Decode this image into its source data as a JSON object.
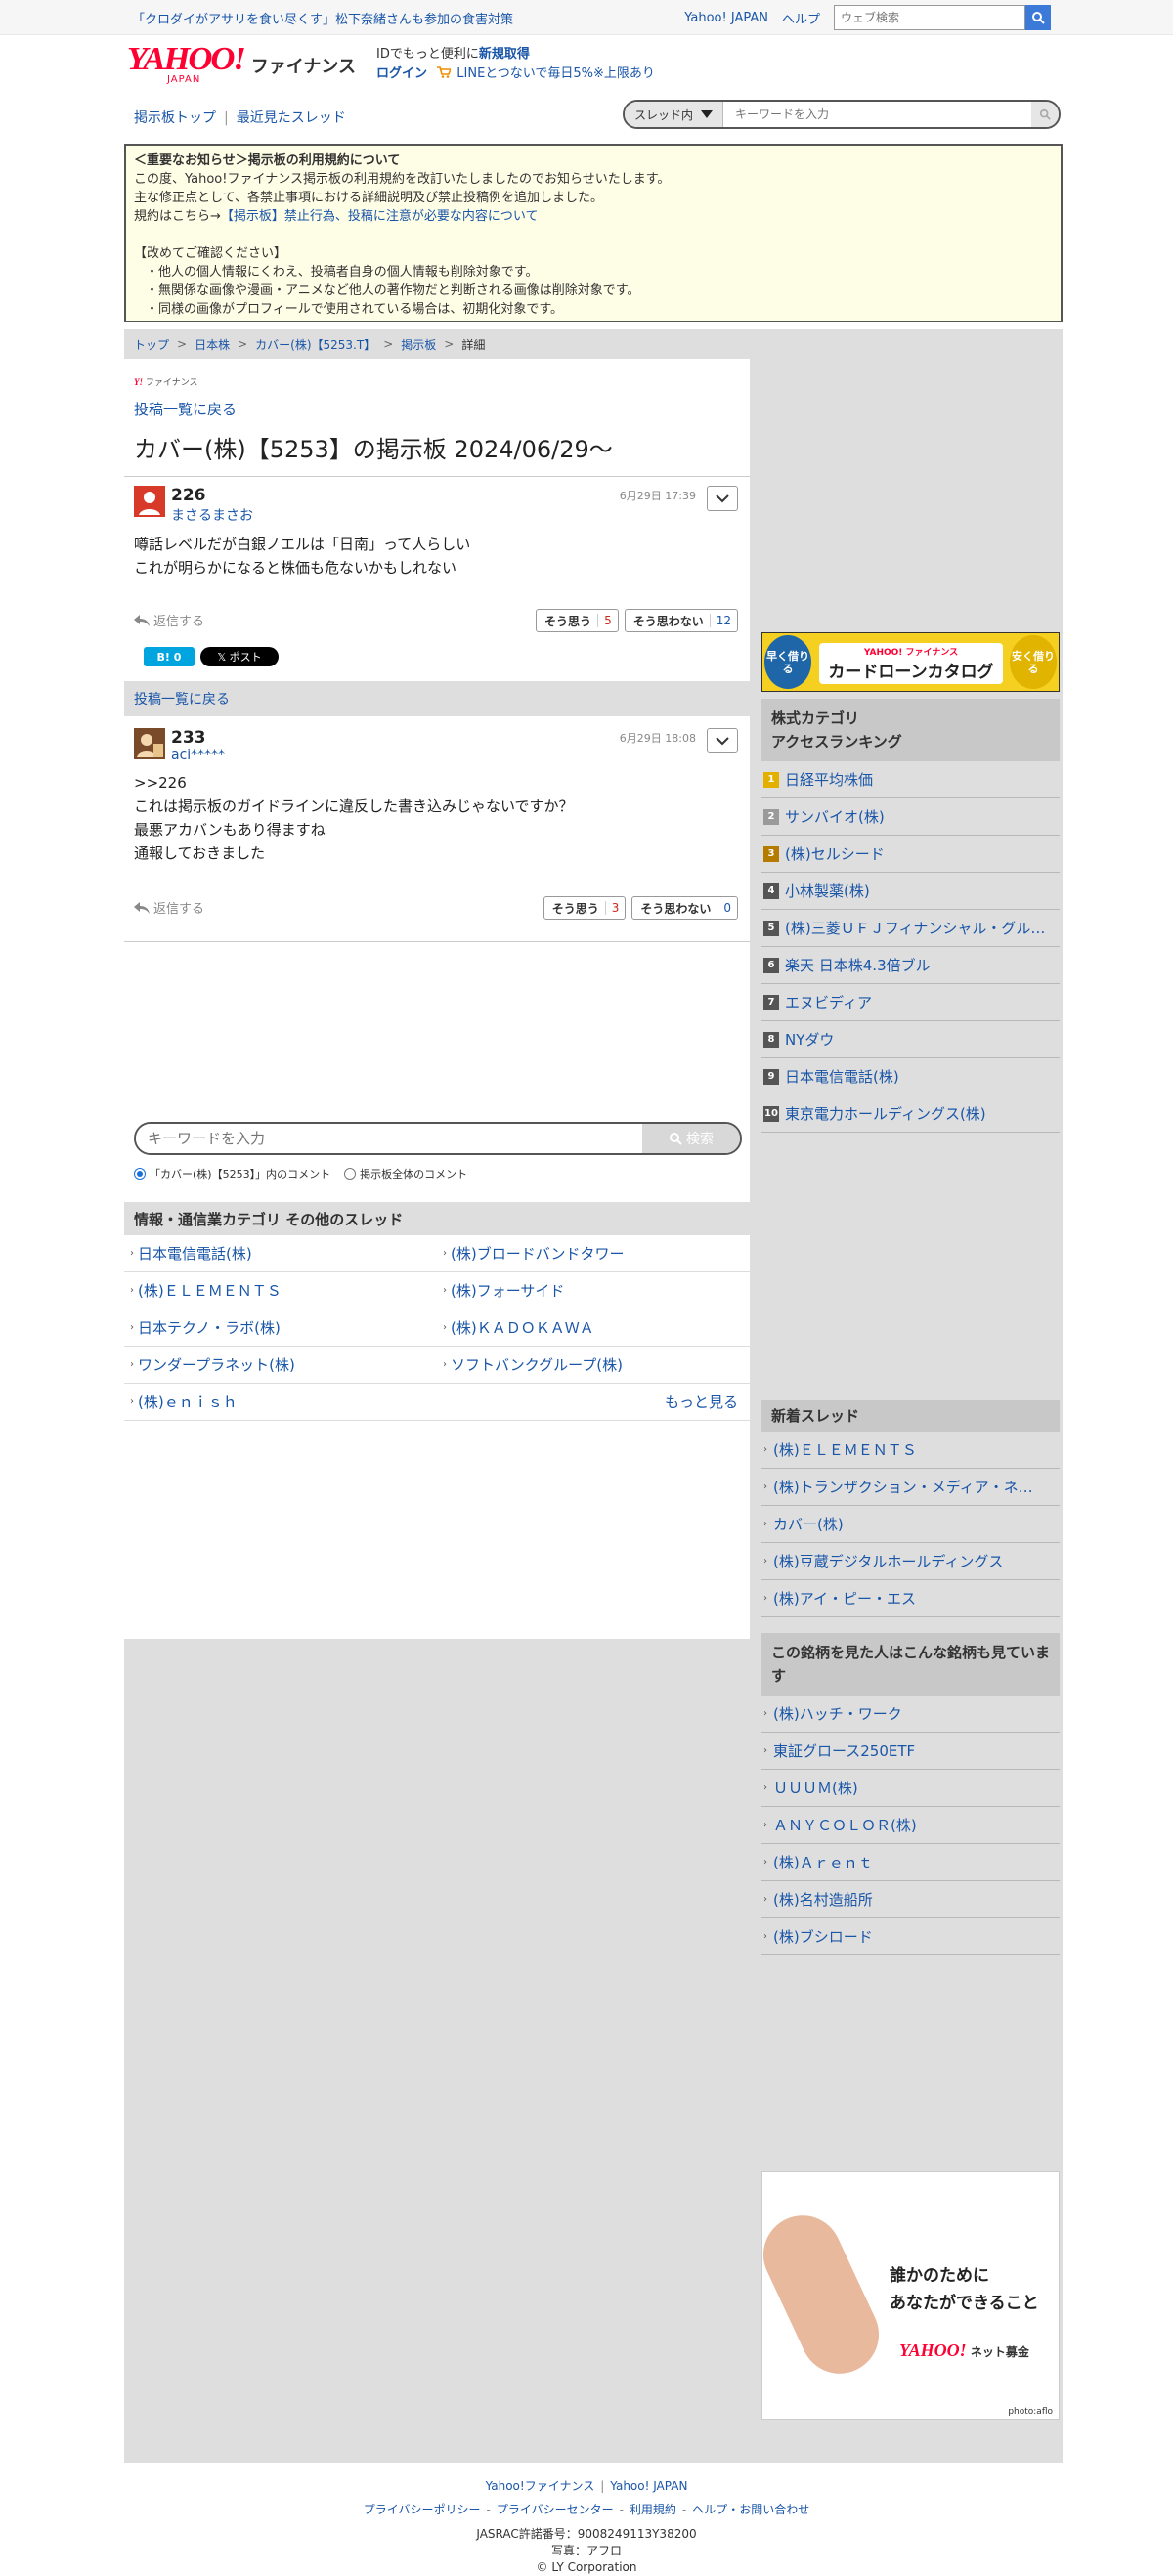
{
  "topbar": {
    "headline": "「クロダイがアサリを食い尽くす」松下奈緒さんも参加の食害対策",
    "yahoo_japan": "Yahoo! JAPAN",
    "help": "ヘルプ",
    "search_placeholder": "ウェブ検索"
  },
  "header": {
    "logo_text": "YAHOO!",
    "logo_sub": "JAPAN",
    "logo_service": "ファイナンス",
    "promo_line1_prefix": "IDでもっと便利に",
    "promo_line1_link": "新規取得",
    "promo_line2_login": "ログイン",
    "promo_line2_text": "LINEとつないで毎日5%※上限あり"
  },
  "nav": {
    "board_top": "掲示板トップ",
    "recent": "最近見たスレッド",
    "scope": "スレッド内",
    "search_placeholder": "キーワードを入力"
  },
  "notice": {
    "title": "＜重要なお知らせ＞掲示板の利用規約について",
    "line1": "この度、Yahoo!ファイナンス掲示板の利用規約を改訂いたしましたのでお知らせいたします。",
    "line2": "主な修正点として、各禁止事項における詳細説明及び禁止投稿例を追加しました。",
    "line3_prefix": "規約はこちら→",
    "line3_link": "【掲示板】禁止行為、投稿に注意が必要な内容について",
    "confirm": "【改めてご確認ください】",
    "bullet1": "・他人の個人情報にくわえ、投稿者自身の個人情報も削除対象です。",
    "bullet2": "・無関係な画像や漫画・アニメなど他人の著作物だと判断される画像は削除対象です。",
    "bullet3": "・同様の画像がプロフィールで使用されている場合は、初期化対象です。"
  },
  "breadcrumb": {
    "items": [
      "トップ",
      "日本株",
      "カバー(株)【5253.T】",
      "掲示板"
    ],
    "current": "詳細"
  },
  "thread": {
    "brand_small": "ファイナンス",
    "back_label": "投稿一覧に戻る",
    "title": "カバー(株)【5253】の掲示板 2024/06/29〜"
  },
  "posts": [
    {
      "number": "226",
      "user": "まさるまさお",
      "time": "6月29日 17:39",
      "line1": "噂話レベルだが白銀ノエルは「日南」って人らしい",
      "line2": "これが明らかになると株価も危ないかもしれない",
      "reply": "返信する",
      "agree_label": "そう思う",
      "agree_count": "5",
      "disagree_label": "そう思わない",
      "disagree_count": "12"
    },
    {
      "number": "233",
      "user": "aci*****",
      "time": "6月29日 18:08",
      "line1": ">>226",
      "line2": "これは掲示板のガイドラインに違反した書き込みじゃないですか？",
      "line3": "最悪アカバンもあり得ますね",
      "line4": "通報しておきました",
      "reply": "返信する",
      "agree_label": "そう思う",
      "agree_count": "3",
      "disagree_label": "そう思わない",
      "disagree_count": "0"
    }
  ],
  "share": {
    "hatena": "B! 0",
    "x_post": "𝕏 ポスト"
  },
  "back_bar": "投稿一覧に戻る",
  "kwsearch": {
    "placeholder": "キーワードを入力",
    "button": "検索",
    "radio_thread": "「カバー(株)【5253】」内のコメント",
    "radio_all": "掲示板全体のコメント"
  },
  "category": {
    "header": "情報・通信業カテゴリ その他のスレッド",
    "items": [
      "日本電信電話(株)",
      "(株)ブロードバンドタワー",
      "(株)ＥＬＥＭＥＮＴＳ",
      "(株)フォーサイド",
      "日本テクノ・ラボ(株)",
      "(株)ＫＡＤＯＫＡＷＡ",
      "ワンダープラネット(株)",
      "ソフトバンクグループ(株)",
      "(株)ｅｎｉｓｈ"
    ],
    "more": "もっと見る"
  },
  "banner": {
    "left": "早く借りる",
    "right": "安く借りる",
    "small": "YAHOO! ファイナンス",
    "big": "カードローンカタログ"
  },
  "ranking": {
    "header_line1": "株式カテゴリ",
    "header_line2": "アクセスランキング",
    "items": [
      "日経平均株価",
      "サンバイオ(株)",
      "(株)セルシード",
      "小林製薬(株)",
      "(株)三菱ＵＦＪフィナンシャル・グループ",
      "楽天 日本株4.3倍ブル",
      "エヌビディア",
      "NYダウ",
      "日本電信電話(株)",
      "東京電力ホールディングス(株)"
    ],
    "ranks": [
      "1",
      "2",
      "3",
      "4",
      "5",
      "6",
      "7",
      "8",
      "9",
      "10"
    ]
  },
  "new_threads": {
    "header": "新着スレッド",
    "items": [
      "(株)ＥＬＥＭＥＮＴＳ",
      "(株)トランザクション・メディア・ネットワークス",
      "カバー(株)",
      "(株)豆蔵デジタルホールディングス",
      "(株)アイ・ピー・エス"
    ]
  },
  "also_viewed": {
    "header": "この銘柄を見た人はこんな銘柄も見ています",
    "items": [
      "(株)ハッチ・ワーク",
      "東証グロース250ETF",
      "ＵＵＵＭ(株)",
      "ＡＮＹＣＯＬＯＲ(株)",
      "(株)Ａｒｅｎｔ",
      "(株)名村造船所",
      "(株)ブシロード"
    ]
  },
  "donate": {
    "line1": "誰かのために",
    "line2": "あなたができること",
    "logo": "YAHOO!",
    "logo_suffix": "ネット募金",
    "photo": "photo:aflo"
  },
  "footer": {
    "link1": "Yahoo!ファイナンス",
    "link2": "Yahoo! JAPAN",
    "policy": "プライバシーポリシー",
    "center": "プライバシーセンター",
    "terms": "利用規約",
    "help": "ヘルプ・お問い合わせ",
    "jasrac": "JASRAC許諾番号：9008249113Y38200",
    "photo": "写真：アフロ",
    "copyright": "© LY Corporation"
  }
}
